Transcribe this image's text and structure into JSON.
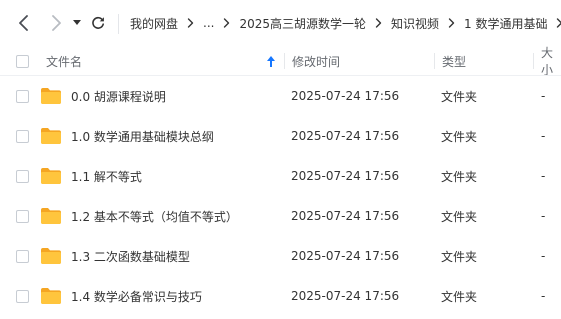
{
  "nav": {
    "back_icon": "chevron-left-icon",
    "forward_icon": "chevron-right-icon",
    "history_dropdown_icon": "caret-down-icon",
    "refresh_icon": "refresh-icon"
  },
  "breadcrumb": {
    "items": [
      "我的网盘",
      "...",
      "2025高三胡源数学一轮",
      "知识视频",
      "1 数学通用基础"
    ],
    "separator_icon": "chevron-right-icon"
  },
  "columns": {
    "name": "文件名",
    "sort_icon": "arrow-up-icon",
    "modified": "修改时间",
    "type": "类型",
    "size": "大小"
  },
  "files": [
    {
      "name": "0.0 胡源课程说明",
      "modified": "2025-07-24 17:56",
      "type": "文件夹",
      "size": "-"
    },
    {
      "name": "1.0 数学通用基础模块总纲",
      "modified": "2025-07-24 17:56",
      "type": "文件夹",
      "size": "-"
    },
    {
      "name": "1.1 解不等式",
      "modified": "2025-07-24 17:56",
      "type": "文件夹",
      "size": "-"
    },
    {
      "name": "1.2 基本不等式（均值不等式）",
      "modified": "2025-07-24 17:56",
      "type": "文件夹",
      "size": "-"
    },
    {
      "name": "1.3 二次函数基础模型",
      "modified": "2025-07-24 17:56",
      "type": "文件夹",
      "size": "-"
    },
    {
      "name": "1.4 数学必备常识与技巧",
      "modified": "2025-07-24 17:56",
      "type": "文件夹",
      "size": "-"
    }
  ],
  "colors": {
    "accent": "#1677ff",
    "folder": "#ffc53d",
    "folder_dark": "#f5a623",
    "text": "#333333",
    "muted": "#666a70"
  }
}
